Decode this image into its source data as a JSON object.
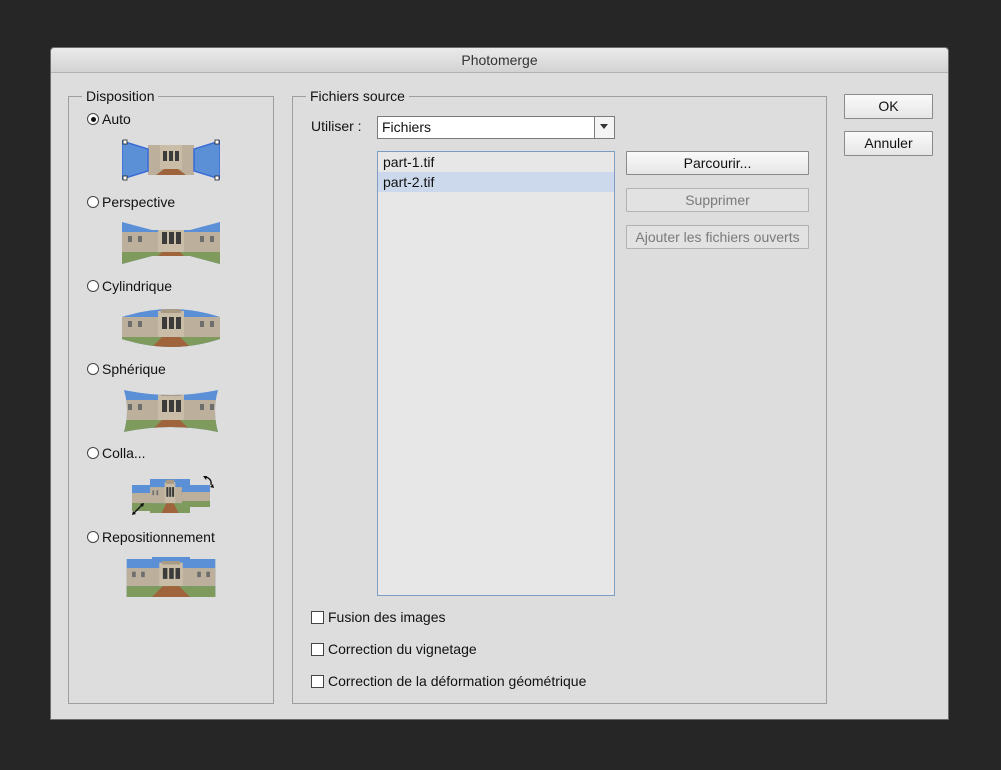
{
  "window": {
    "title": "Photomerge"
  },
  "disposition": {
    "legend": "Disposition",
    "options": [
      {
        "label": "Auto",
        "checked": true
      },
      {
        "label": "Perspective",
        "checked": false
      },
      {
        "label": "Cylindrique",
        "checked": false
      },
      {
        "label": "Sphérique",
        "checked": false
      },
      {
        "label": "Colla...",
        "checked": false
      },
      {
        "label": "Repositionnement",
        "checked": false
      }
    ]
  },
  "source": {
    "legend": "Fichiers source",
    "use_label": "Utiliser :",
    "use_value": "Fichiers",
    "files": [
      {
        "name": "part-1.tif",
        "selected": false
      },
      {
        "name": "part-2.tif",
        "selected": true
      }
    ],
    "browse_label": "Parcourir...",
    "remove_label": "Supprimer",
    "add_open_label": "Ajouter les fichiers ouverts",
    "checkboxes": [
      {
        "label": "Fusion des images",
        "checked": false
      },
      {
        "label": "Correction du vignetage",
        "checked": false
      },
      {
        "label": "Correction de la déformation géométrique",
        "checked": false
      }
    ]
  },
  "actions": {
    "ok_label": "OK",
    "cancel_label": "Annuler"
  },
  "colors": {
    "sky": "#5b8fd6",
    "building": "#b8aa94",
    "ground": "#a0643c",
    "selection": "#ccd8ec",
    "handle_blue": "#3a6bd6"
  }
}
